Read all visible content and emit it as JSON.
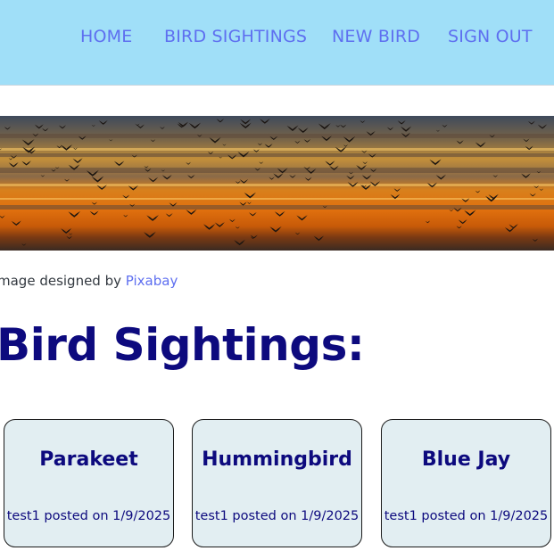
{
  "nav": {
    "items": [
      {
        "label": "HOME"
      },
      {
        "label": "BIRD SIGHTINGS"
      },
      {
        "label": "NEW BIRD"
      },
      {
        "label": "SIGN OUT"
      }
    ]
  },
  "banner": {
    "credit_prefix": "mage designed by ",
    "credit_link": "Pixabay"
  },
  "page": {
    "title": "Bird Sightings:"
  },
  "cards": [
    {
      "title": "Parakeet",
      "meta": "test1 posted on 1/9/2025"
    },
    {
      "title": "Hummingbird",
      "meta": "test1 posted on 1/9/2025"
    },
    {
      "title": "Blue Jay",
      "meta": "test1 posted on 1/9/2025"
    }
  ],
  "colors": {
    "navbar_bg": "#a0dff8",
    "link": "#5e6ff0",
    "heading": "#0d0a7e",
    "card_bg": "#e2eef2"
  }
}
